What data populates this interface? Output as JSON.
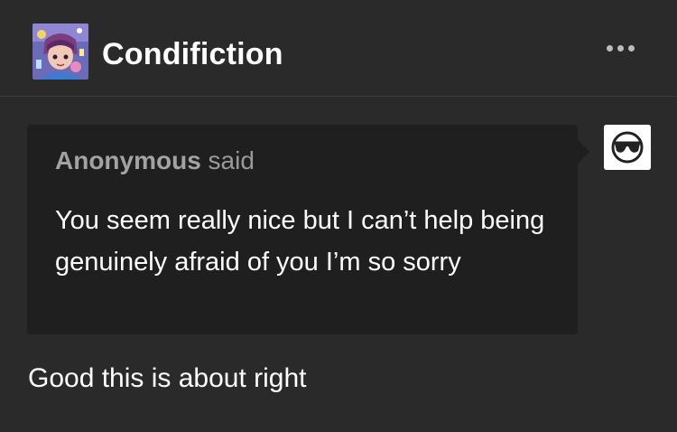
{
  "post": {
    "blog_name": "Condifiction",
    "more_menu_icon": "ellipsis-icon",
    "ask": {
      "asker_name": "Anonymous",
      "said_label": " said",
      "question": "You seem really nice but I can’t help being genuinely afraid of you I’m so sorry",
      "asker_avatar_icon": "anonymous-sunglasses-icon"
    },
    "answer": "Good this is about right"
  },
  "colors": {
    "background": "#2a2a2a",
    "ask_box": "#1f1f1f",
    "asker_text": "#9a9a9a",
    "text": "#ffffff"
  }
}
